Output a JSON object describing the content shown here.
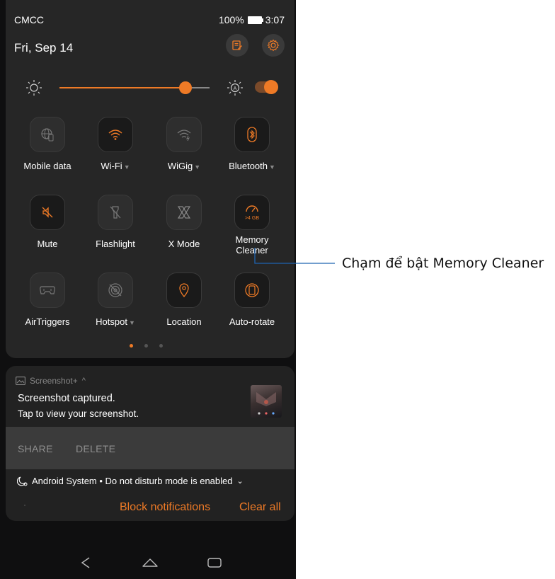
{
  "status_bar": {
    "carrier": "CMCC",
    "battery": "100%",
    "time": "3:07"
  },
  "header": {
    "date": "Fri, Sep 14",
    "edit_icon": "edit-icon",
    "settings_icon": "gear-icon"
  },
  "brightness": {
    "level": 0.84,
    "auto_enabled": true
  },
  "tiles": [
    {
      "label": "Mobile data",
      "icon": "globe-icon",
      "has_caret": false,
      "active": false
    },
    {
      "label": "Wi-Fi",
      "icon": "wifi-icon",
      "has_caret": true,
      "active": true
    },
    {
      "label": "WiGig",
      "icon": "wigig-icon",
      "has_caret": true,
      "active": false
    },
    {
      "label": "Bluetooth",
      "icon": "bluetooth-icon",
      "has_caret": true,
      "active": true
    },
    {
      "label": "Mute",
      "icon": "mute-icon",
      "has_caret": false,
      "active": true
    },
    {
      "label": "Flashlight",
      "icon": "flashlight-icon",
      "has_caret": false,
      "active": false
    },
    {
      "label": "X Mode",
      "icon": "x-mode-icon",
      "has_caret": false,
      "active": false
    },
    {
      "label": "Memory\nCleaner",
      "icon": "memory-cleaner-icon",
      "badge": ">4 GB",
      "has_caret": false,
      "active": true
    },
    {
      "label": "AirTriggers",
      "icon": "airtriggers-icon",
      "has_caret": false,
      "active": false
    },
    {
      "label": "Hotspot",
      "icon": "hotspot-icon",
      "has_caret": true,
      "active": false
    },
    {
      "label": "Location",
      "icon": "location-icon",
      "has_caret": false,
      "active": true
    },
    {
      "label": "Auto-rotate",
      "icon": "auto-rotate-icon",
      "has_caret": false,
      "active": true
    }
  ],
  "page_indicator": {
    "pages": 3,
    "current": 1
  },
  "notification": {
    "app": "Screenshot+",
    "title": "Screenshot captured.",
    "text": "Tap to view your screenshot.",
    "actions": [
      "SHARE",
      "DELETE"
    ]
  },
  "dnd": {
    "text": "Android System • Do not disturb mode is enabled"
  },
  "bottom_actions": {
    "block": "Block notifications",
    "clear": "Clear all"
  },
  "callout": {
    "text": "Chạm để bật Memory Cleaner"
  },
  "colors": {
    "accent": "#ee7a26",
    "panel": "#262626",
    "background": "#0f0f10"
  }
}
